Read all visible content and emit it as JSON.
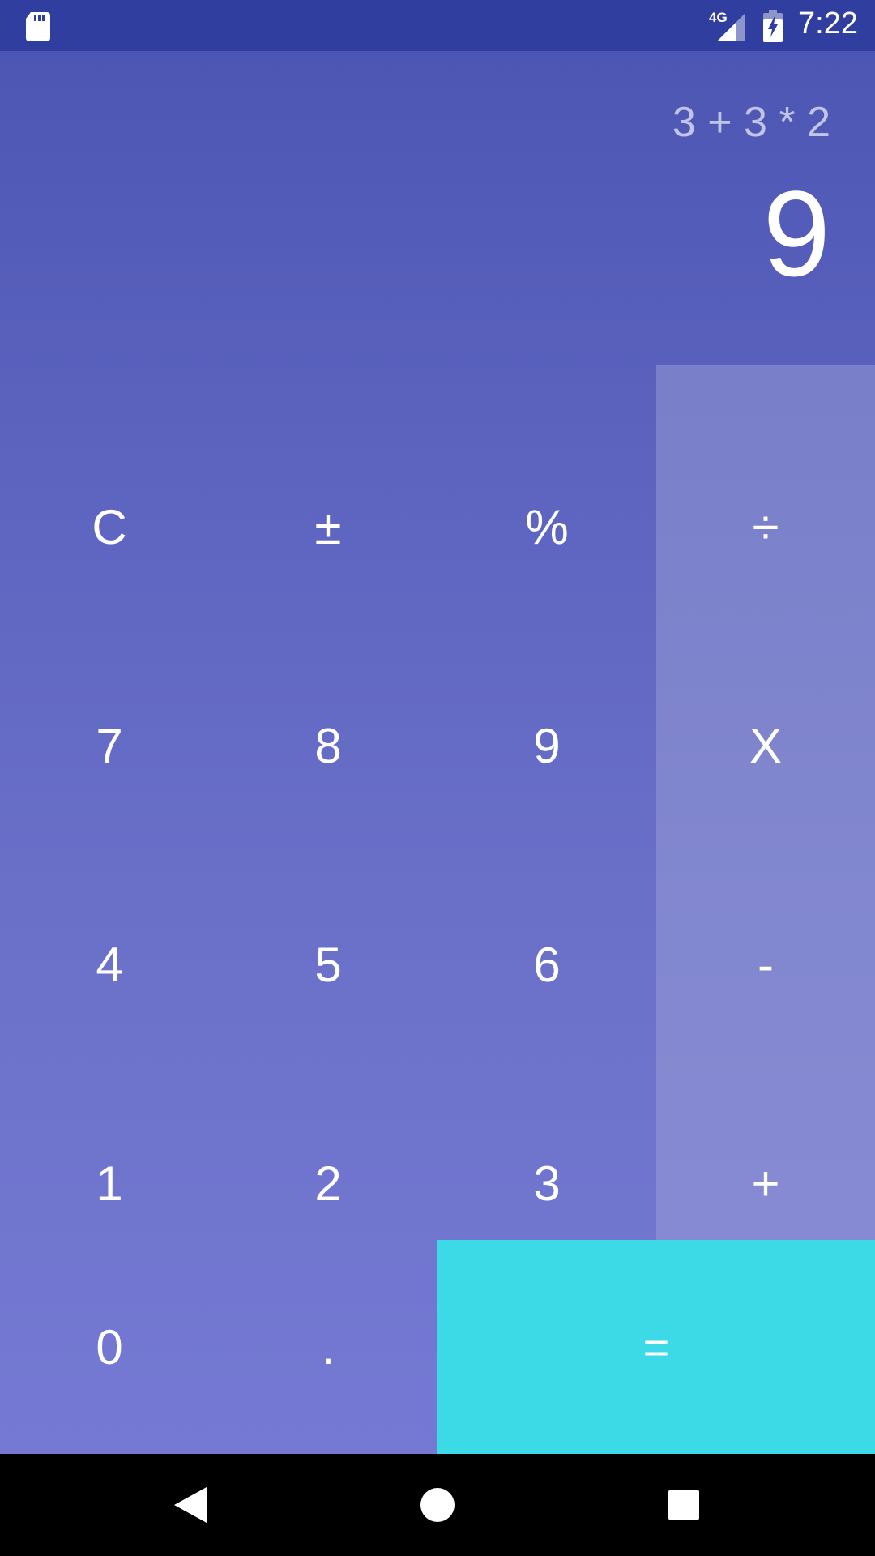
{
  "status_bar": {
    "network": "4G",
    "time": "7:22",
    "icons": [
      "sd-card-icon",
      "signal-icon",
      "battery-charging-icon"
    ]
  },
  "display": {
    "expression": "3 + 3 * 2",
    "result": "9"
  },
  "keypad": {
    "row1": [
      "C",
      "±",
      "%",
      "÷"
    ],
    "row2": [
      "7",
      "8",
      "9",
      "X"
    ],
    "row3": [
      "4",
      "5",
      "6",
      "-"
    ],
    "row4": [
      "1",
      "2",
      "3",
      "+"
    ],
    "row5": [
      "0",
      ".",
      "="
    ]
  },
  "navigation": {
    "icons": [
      "back-icon",
      "home-icon",
      "recents-icon"
    ]
  },
  "colors": {
    "status_bar": "#303F9F",
    "gradient_top": "#4E56B4",
    "gradient_bottom": "#7579D3",
    "equals_key": "#3CDAE6",
    "text": "#FFFFFF"
  }
}
